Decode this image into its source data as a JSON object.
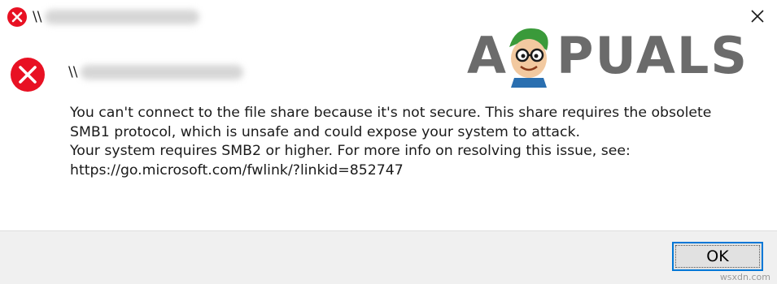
{
  "titlebar": {
    "title_prefix": "\\\\",
    "close_icon": "close-x-icon"
  },
  "header": {
    "path_prefix": "\\\\"
  },
  "logo": {
    "text_left": "A",
    "text_right": "PUALS"
  },
  "error_icon": "error-x-icon",
  "message": {
    "lines": [
      "You can't connect to the file share because it's not secure. This share requires the obsolete",
      "SMB1 protocol, which is unsafe and could expose your system to attack.",
      "Your system requires SMB2 or higher. For more info on resolving this issue, see:",
      "https://go.microsoft.com/fwlink/?linkid=852747"
    ]
  },
  "footer": {
    "ok_label": "OK"
  },
  "watermark": "wsxdn.com",
  "colors": {
    "error_red": "#e81123",
    "focus_blue": "#0078d7",
    "footer_bg": "#f0f0f0"
  }
}
